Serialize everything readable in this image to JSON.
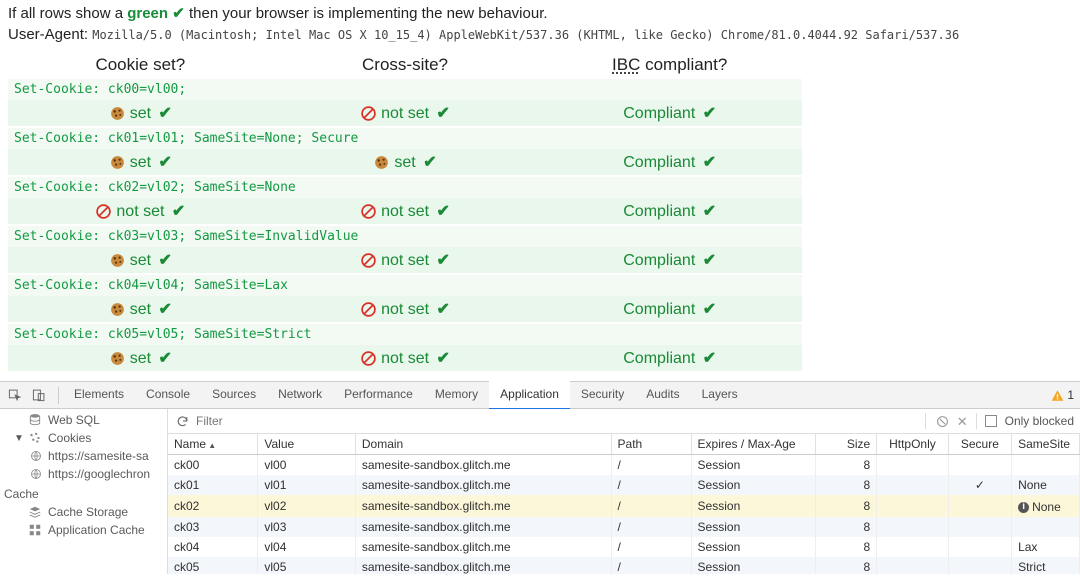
{
  "intro": {
    "prefix": "If all rows show a ",
    "green_word": "green",
    "check_glyph": "✔",
    "suffix": " then your browser is implementing the new behaviour."
  },
  "ua": {
    "label": "User-Agent:",
    "value": "Mozilla/5.0 (Macintosh; Intel Mac OS X 10_15_4) AppleWebKit/537.36 (KHTML, like Gecko) Chrome/81.0.4044.92 Safari/537.36"
  },
  "headers": {
    "cookie_set": "Cookie set?",
    "cross_site": "Cross-site?",
    "ibc_abbr": "IBC",
    "ibc_suffix": " compliant?"
  },
  "labels": {
    "set": "set",
    "not_set": "not set",
    "compliant": "Compliant",
    "check": "✔"
  },
  "tests": [
    {
      "header": "Set-Cookie: ck00=vl00;",
      "set": true,
      "cross_set": false
    },
    {
      "header": "Set-Cookie: ck01=vl01; SameSite=None; Secure",
      "set": true,
      "cross_set": true
    },
    {
      "header": "Set-Cookie: ck02=vl02; SameSite=None",
      "set": false,
      "cross_set": false
    },
    {
      "header": "Set-Cookie: ck03=vl03; SameSite=InvalidValue",
      "set": true,
      "cross_set": false
    },
    {
      "header": "Set-Cookie: ck04=vl04; SameSite=Lax",
      "set": true,
      "cross_set": false
    },
    {
      "header": "Set-Cookie: ck05=vl05; SameSite=Strict",
      "set": true,
      "cross_set": false
    }
  ],
  "devtools": {
    "tabs": [
      "Elements",
      "Console",
      "Sources",
      "Network",
      "Performance",
      "Memory",
      "Application",
      "Security",
      "Audits",
      "Layers"
    ],
    "active_tab": 6,
    "warn_count": "1",
    "sidebar": {
      "section_items_top": [
        {
          "label": "Web SQL",
          "icon": "db"
        },
        {
          "label": "Cookies",
          "icon": "cookie",
          "expanded": true
        },
        {
          "label": "https://samesite-sa",
          "icon": "globe",
          "nested": true
        },
        {
          "label": "https://googlechron",
          "icon": "globe",
          "nested": true
        }
      ],
      "section_heading": "Cache",
      "section_items_cache": [
        {
          "label": "Cache Storage",
          "icon": "stack"
        },
        {
          "label": "Application Cache",
          "icon": "grid"
        }
      ]
    },
    "filter": {
      "placeholder": "Filter",
      "only_blocked": "Only blocked"
    },
    "cookie_cols": [
      "Name",
      "Value",
      "Domain",
      "Path",
      "Expires / Max-Age",
      "Size",
      "HttpOnly",
      "Secure",
      "SameSite"
    ],
    "cookie_rows": [
      {
        "name": "ck00",
        "value": "vl00",
        "domain": "samesite-sandbox.glitch.me",
        "path": "/",
        "exp": "Session",
        "size": "8",
        "http": "",
        "secure": "",
        "ss": ""
      },
      {
        "name": "ck01",
        "value": "vl01",
        "domain": "samesite-sandbox.glitch.me",
        "path": "/",
        "exp": "Session",
        "size": "8",
        "http": "",
        "secure": "✓",
        "ss": "None"
      },
      {
        "name": "ck02",
        "value": "vl02",
        "domain": "samesite-sandbox.glitch.me",
        "path": "/",
        "exp": "Session",
        "size": "8",
        "http": "",
        "secure": "",
        "ss": "! None",
        "hl": true
      },
      {
        "name": "ck03",
        "value": "vl03",
        "domain": "samesite-sandbox.glitch.me",
        "path": "/",
        "exp": "Session",
        "size": "8",
        "http": "",
        "secure": "",
        "ss": ""
      },
      {
        "name": "ck04",
        "value": "vl04",
        "domain": "samesite-sandbox.glitch.me",
        "path": "/",
        "exp": "Session",
        "size": "8",
        "http": "",
        "secure": "",
        "ss": "Lax"
      },
      {
        "name": "ck05",
        "value": "vl05",
        "domain": "samesite-sandbox.glitch.me",
        "path": "/",
        "exp": "Session",
        "size": "8",
        "http": "",
        "secure": "",
        "ss": "Strict"
      }
    ]
  }
}
